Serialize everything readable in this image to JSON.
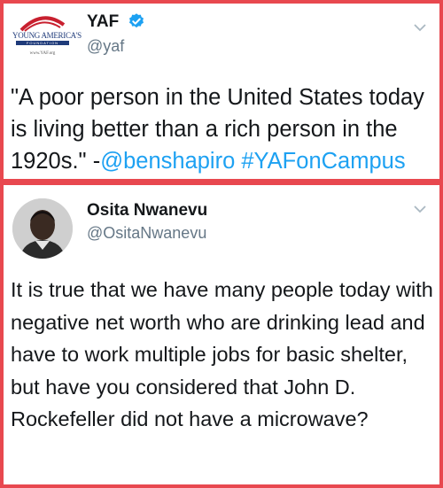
{
  "tweets": [
    {
      "display_name": "YAF",
      "handle": "@yaf",
      "verified": true,
      "avatar_icon": "yaf-logo-icon",
      "avatar_logo_text": {
        "wordmark": "YOUNG AMERICA'S",
        "stripe": "FOUNDATION",
        "url": "www.YAF.org"
      },
      "text_parts": [
        "\"A poor person in the United States today is living better than a rich person in the 1920s.\" -",
        "@benshapiro",
        " ",
        "#YAFonCampus"
      ]
    },
    {
      "display_name": "Osita Nwanevu",
      "handle": "@OsitaNwanevu",
      "verified": false,
      "avatar_icon": "profile-photo-avatar",
      "text": "It is true that we have many people today with negative net worth who are drinking lead and have to work multiple jobs for basic shelter, but have you considered that John D. Rockefeller did not have a microwave?"
    }
  ],
  "colors": {
    "frame": "#e8484f",
    "link": "#1da1f2",
    "verified": "#1da1f2",
    "handle": "#657786",
    "text": "#14171a"
  }
}
